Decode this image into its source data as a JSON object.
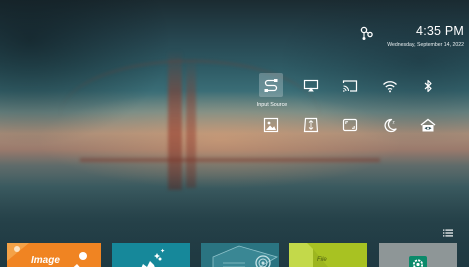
{
  "status": {
    "time": "4:35 PM",
    "date": "Wednesday, September 14, 2022",
    "network_icon": "network-settings-icon"
  },
  "quick_settings": {
    "selected_label": "Input Source",
    "row1": [
      {
        "icon": "input-source-icon",
        "selected": true
      },
      {
        "icon": "screen-mirroring-icon",
        "selected": false
      },
      {
        "icon": "cast-icon",
        "selected": false
      },
      {
        "icon": "wifi-icon",
        "selected": false
      },
      {
        "icon": "bluetooth-icon",
        "selected": false
      }
    ],
    "row2": [
      {
        "icon": "picture-icon",
        "selected": false
      },
      {
        "icon": "keystone-icon",
        "selected": false
      },
      {
        "icon": "aspect-ratio-icon",
        "selected": false
      },
      {
        "icon": "sleep-timer-icon",
        "selected": false
      },
      {
        "icon": "eye-protection-icon",
        "selected": false
      }
    ]
  },
  "menu_icon": "list-menu-icon",
  "apps": [
    {
      "label": "Image",
      "color": "#f08422"
    },
    {
      "label": "",
      "color": "#16889a"
    },
    {
      "label": "",
      "color": "#2a7481"
    },
    {
      "label": "File",
      "color": "#a8c222"
    },
    {
      "label": "",
      "color": "#8e9697"
    }
  ]
}
